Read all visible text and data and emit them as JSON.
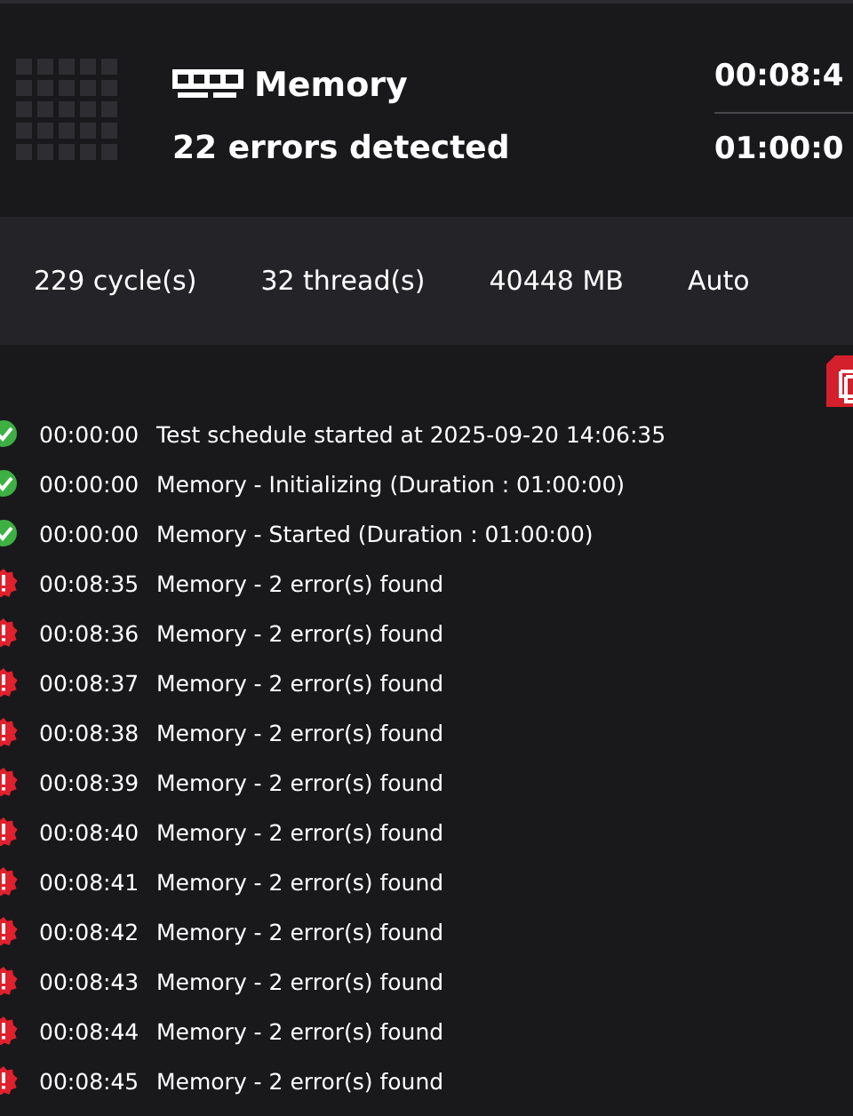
{
  "header": {
    "title": "Memory",
    "subtitle": "22 errors detected",
    "elapsed": "00:08:4",
    "duration": "01:00:0"
  },
  "stats": [
    "229 cycle(s)",
    "32 thread(s)",
    "40448 MB",
    "Auto"
  ],
  "log": [
    {
      "kind": "success",
      "time": "00:00:00",
      "message": "Test schedule started at 2025-09-20 14:06:35"
    },
    {
      "kind": "success",
      "time": "00:00:00",
      "message": "Memory - Initializing (Duration : 01:00:00)"
    },
    {
      "kind": "success",
      "time": "00:00:00",
      "message": "Memory - Started (Duration : 01:00:00)"
    },
    {
      "kind": "error",
      "time": "00:08:35",
      "message": "Memory - 2 error(s) found"
    },
    {
      "kind": "error",
      "time": "00:08:36",
      "message": "Memory - 2 error(s) found"
    },
    {
      "kind": "error",
      "time": "00:08:37",
      "message": "Memory - 2 error(s) found"
    },
    {
      "kind": "error",
      "time": "00:08:38",
      "message": "Memory - 2 error(s) found"
    },
    {
      "kind": "error",
      "time": "00:08:39",
      "message": "Memory - 2 error(s) found"
    },
    {
      "kind": "error",
      "time": "00:08:40",
      "message": "Memory - 2 error(s) found"
    },
    {
      "kind": "error",
      "time": "00:08:41",
      "message": "Memory - 2 error(s) found"
    },
    {
      "kind": "error",
      "time": "00:08:42",
      "message": "Memory - 2 error(s) found"
    },
    {
      "kind": "error",
      "time": "00:08:43",
      "message": "Memory - 2 error(s) found"
    },
    {
      "kind": "error",
      "time": "00:08:44",
      "message": "Memory - 2 error(s) found"
    },
    {
      "kind": "error",
      "time": "00:08:45",
      "message": "Memory - 2 error(s) found"
    }
  ]
}
